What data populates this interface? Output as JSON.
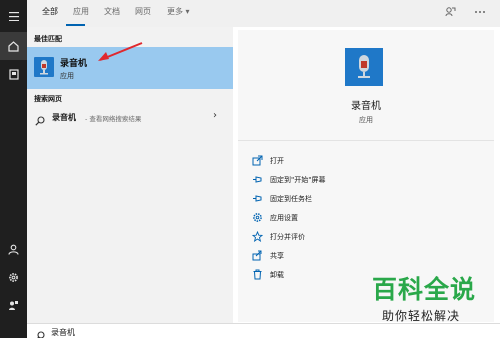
{
  "tabs": [
    "全部",
    "应用",
    "文档",
    "网页",
    "更多 ▾"
  ],
  "left_panel": {
    "best_match_label": "最佳匹配",
    "best_match": {
      "title": "录音机",
      "subtitle": "应用"
    },
    "web_section_label": "搜索网页",
    "web_result": {
      "query": "录音机",
      "description": "- 查看网络搜索结果"
    }
  },
  "detail": {
    "app_name": "录音机",
    "app_type": "应用",
    "actions": [
      "打开",
      "固定到\"开始\"屏幕",
      "固定到任务栏",
      "应用设置",
      "打分并评价",
      "共享",
      "卸载"
    ]
  },
  "search": {
    "value": "录音机"
  },
  "watermark": {
    "title": "百科全说",
    "subtitle": "助你轻松解决"
  },
  "colors": {
    "accent": "#0063b1",
    "highlight": "#99c9ef",
    "app_tile": "#1f78c8",
    "rail": "#1f1f1f",
    "watermark": "#2aa84a"
  }
}
